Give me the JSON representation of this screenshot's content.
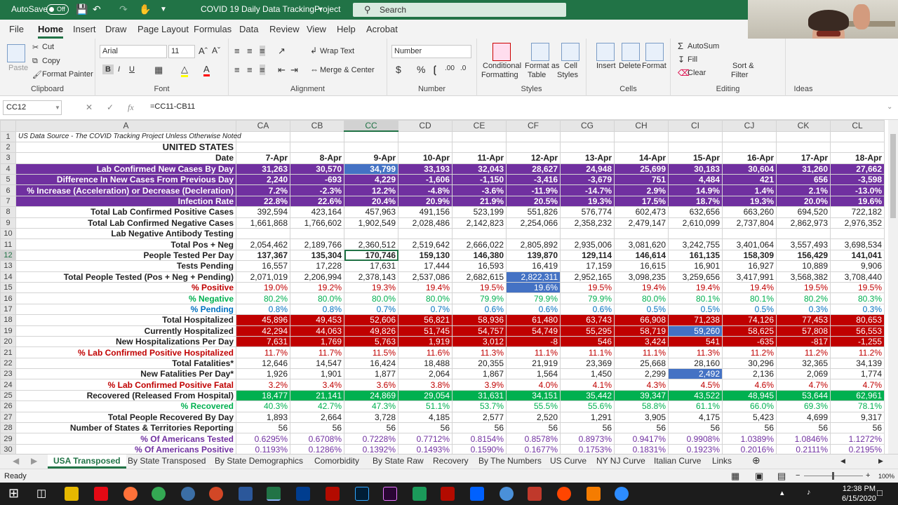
{
  "titlebar": {
    "autosave": "AutoSave",
    "autosave_state": "Off",
    "document": "COVID 19 Daily Data TrackingProject",
    "search_placeholder": "Search"
  },
  "menu": [
    "File",
    "Home",
    "Insert",
    "Draw",
    "Page Layout",
    "Formulas",
    "Data",
    "Review",
    "View",
    "Help",
    "Acrobat"
  ],
  "ribbon": {
    "clipboard": {
      "label": "Clipboard",
      "paste": "Paste",
      "cut": "Cut",
      "copy": "Copy",
      "format_painter": "Format Painter"
    },
    "font": {
      "label": "Font",
      "family": "Arial",
      "size": "11"
    },
    "alignment": {
      "label": "Alignment",
      "wrap": "Wrap Text",
      "merge": "Merge & Center"
    },
    "number": {
      "label": "Number",
      "format": "Number"
    },
    "styles": {
      "label": "Styles",
      "conditional": "Conditional",
      "formatting": "Formatting",
      "format_as": "Format as",
      "table": "Table",
      "cell": "Cell",
      "cell_styles": "Styles"
    },
    "cells": {
      "label": "Cells",
      "insert": "Insert",
      "delete": "Delete",
      "format": "Format"
    },
    "editing": {
      "label": "Editing",
      "autosum": "AutoSum",
      "fill": "Fill",
      "clear": "Clear",
      "sort": "Sort &",
      "filter": "Filter"
    },
    "ideas": {
      "label": "Ideas"
    }
  },
  "formula_bar": {
    "cell": "CC12",
    "formula": "=CC11-CB11"
  },
  "columns": [
    "",
    "A",
    "CA",
    "CB",
    "CC",
    "CD",
    "CE",
    "CF",
    "CG",
    "CH",
    "CI",
    "CJ",
    "CK",
    "CL"
  ],
  "rows": [
    {
      "n": "1",
      "label": "US Data Source - The COVID Tracking Project Unless Otherwise Noted",
      "v": [
        "",
        "",
        "",
        "",
        "",
        "",
        "",
        "",
        "",
        "",
        "",
        ""
      ]
    },
    {
      "n": "2",
      "label": "UNITED STATES",
      "v": [
        "",
        "",
        "",
        "",
        "",
        "",
        "",
        "",
        "",
        "",
        "",
        ""
      ]
    },
    {
      "n": "3",
      "label": "Date",
      "v": [
        "7-Apr",
        "8-Apr",
        "9-Apr",
        "10-Apr",
        "11-Apr",
        "12-Apr",
        "13-Apr",
        "14-Apr",
        "15-Apr",
        "16-Apr",
        "17-Apr",
        "18-Apr"
      ]
    },
    {
      "n": "4",
      "label": "Lab Confirmed New Cases By Day",
      "v": [
        "31,263",
        "30,570",
        "34,799",
        "33,193",
        "32,043",
        "28,627",
        "24,948",
        "25,699",
        "30,183",
        "30,604",
        "31,260",
        "27,662"
      ]
    },
    {
      "n": "5",
      "label": "Difference In New Cases From Previous Day",
      "v": [
        "2,240",
        "-693",
        "4,229",
        "-1,606",
        "-1,150",
        "-3,416",
        "-3,679",
        "751",
        "4,484",
        "421",
        "656",
        "-3,598"
      ]
    },
    {
      "n": "6",
      "label": "% Increase (Acceleration) or Decrease (Decleration)",
      "v": [
        "7.2%",
        "-2.3%",
        "12.2%",
        "-4.8%",
        "-3.6%",
        "-11.9%",
        "-14.7%",
        "2.9%",
        "14.9%",
        "1.4%",
        "2.1%",
        "-13.0%"
      ]
    },
    {
      "n": "7",
      "label": "Infection Rate",
      "v": [
        "22.8%",
        "22.6%",
        "20.4%",
        "20.9%",
        "21.9%",
        "20.5%",
        "19.3%",
        "17.5%",
        "18.7%",
        "19.3%",
        "20.0%",
        "19.6%"
      ]
    },
    {
      "n": "8",
      "label": "Total Lab Confirmed Positive Cases",
      "v": [
        "392,594",
        "423,164",
        "457,963",
        "491,156",
        "523,199",
        "551,826",
        "576,774",
        "602,473",
        "632,656",
        "663,260",
        "694,520",
        "722,182"
      ]
    },
    {
      "n": "9",
      "label": "Total Lab Confirmed Negative Cases",
      "v": [
        "1,661,868",
        "1,766,602",
        "1,902,549",
        "2,028,486",
        "2,142,823",
        "2,254,066",
        "2,358,232",
        "2,479,147",
        "2,610,099",
        "2,737,804",
        "2,862,973",
        "2,976,352"
      ]
    },
    {
      "n": "10",
      "label": "Lab Negative Antibody Testing",
      "v": [
        "",
        "",
        "",
        "",
        "",
        "",
        "",
        "",
        "",
        "",
        "",
        ""
      ]
    },
    {
      "n": "11",
      "label": "Total Pos + Neg",
      "v": [
        "2,054,462",
        "2,189,766",
        "2,360,512",
        "2,519,642",
        "2,666,022",
        "2,805,892",
        "2,935,006",
        "3,081,620",
        "3,242,755",
        "3,401,064",
        "3,557,493",
        "3,698,534"
      ]
    },
    {
      "n": "12",
      "label": "People Tested Per Day",
      "v": [
        "137,367",
        "135,304",
        "170,746",
        "159,130",
        "146,380",
        "139,870",
        "129,114",
        "146,614",
        "161,135",
        "158,309",
        "156,429",
        "141,041"
      ]
    },
    {
      "n": "13",
      "label": "Tests Pending",
      "v": [
        "16,557",
        "17,228",
        "17,631",
        "17,444",
        "16,593",
        "16,419",
        "17,159",
        "16,615",
        "16,901",
        "16,927",
        "10,889",
        "9,906"
      ]
    },
    {
      "n": "14",
      "label": "Total People Tested (Pos + Neg + Pending)",
      "v": [
        "2,071,019",
        "2,206,994",
        "2,378,143",
        "2,537,086",
        "2,682,615",
        "2,822,311",
        "2,952,165",
        "3,098,235",
        "3,259,656",
        "3,417,991",
        "3,568,382",
        "3,708,440"
      ]
    },
    {
      "n": "15",
      "label": "% Positive",
      "v": [
        "19.0%",
        "19.2%",
        "19.3%",
        "19.4%",
        "19.5%",
        "19.6%",
        "19.5%",
        "19.4%",
        "19.4%",
        "19.4%",
        "19.5%",
        "19.5%"
      ]
    },
    {
      "n": "16",
      "label": "% Negative",
      "v": [
        "80.2%",
        "80.0%",
        "80.0%",
        "80.0%",
        "79.9%",
        "79.9%",
        "79.9%",
        "80.0%",
        "80.1%",
        "80.1%",
        "80.2%",
        "80.3%"
      ]
    },
    {
      "n": "17",
      "label": "% Pending",
      "v": [
        "0.8%",
        "0.8%",
        "0.7%",
        "0.7%",
        "0.6%",
        "0.6%",
        "0.6%",
        "0.5%",
        "0.5%",
        "0.5%",
        "0.3%",
        "0.3%"
      ]
    },
    {
      "n": "18",
      "label": "Total Hospitalized",
      "v": [
        "45,896",
        "49,453",
        "52,606",
        "56,821",
        "58,936",
        "61,480",
        "63,743",
        "66,908",
        "71,238",
        "74,126",
        "77,453",
        "80,653"
      ]
    },
    {
      "n": "19",
      "label": "Currently Hospitalized",
      "v": [
        "42,294",
        "44,063",
        "49,826",
        "51,745",
        "54,757",
        "54,749",
        "55,295",
        "58,719",
        "59,260",
        "58,625",
        "57,808",
        "56,553"
      ]
    },
    {
      "n": "20",
      "label": "New Hospitalizations Per Day",
      "v": [
        "7,631",
        "1,769",
        "5,763",
        "1,919",
        "3,012",
        "-8",
        "546",
        "3,424",
        "541",
        "-635",
        "-817",
        "-1,255"
      ]
    },
    {
      "n": "21",
      "label": "% Lab Confirmed Positive Hospitalized",
      "v": [
        "11.7%",
        "11.7%",
        "11.5%",
        "11.6%",
        "11.3%",
        "11.1%",
        "11.1%",
        "11.1%",
        "11.3%",
        "11.2%",
        "11.2%",
        "11.2%"
      ]
    },
    {
      "n": "22",
      "label": "Total Fatalities*",
      "v": [
        "12,646",
        "14,547",
        "16,424",
        "18,488",
        "20,355",
        "21,919",
        "23,369",
        "25,668",
        "28,160",
        "30,296",
        "32,365",
        "34,139"
      ]
    },
    {
      "n": "23",
      "label": "New Fatalities Per Day*",
      "v": [
        "1,926",
        "1,901",
        "1,877",
        "2,064",
        "1,867",
        "1,564",
        "1,450",
        "2,299",
        "2,492",
        "2,136",
        "2,069",
        "1,774"
      ]
    },
    {
      "n": "24",
      "label": "% Lab Confirmed Positive Fatal",
      "v": [
        "3.2%",
        "3.4%",
        "3.6%",
        "3.8%",
        "3.9%",
        "4.0%",
        "4.1%",
        "4.3%",
        "4.5%",
        "4.6%",
        "4.7%",
        "4.7%"
      ]
    },
    {
      "n": "25",
      "label": "Recovered (Released From Hospital)",
      "v": [
        "18,477",
        "21,141",
        "24,869",
        "29,054",
        "31,631",
        "34,151",
        "35,442",
        "39,347",
        "43,522",
        "48,945",
        "53,644",
        "62,961"
      ]
    },
    {
      "n": "26",
      "label": "% Recovered",
      "v": [
        "40.3%",
        "42.7%",
        "47.3%",
        "51.1%",
        "53.7%",
        "55.5%",
        "55.6%",
        "58.8%",
        "61.1%",
        "66.0%",
        "69.3%",
        "78.1%"
      ]
    },
    {
      "n": "27",
      "label": "Total People Recovered By Day",
      "v": [
        "1,893",
        "2,664",
        "3,728",
        "4,185",
        "2,577",
        "2,520",
        "1,291",
        "3,905",
        "4,175",
        "5,423",
        "4,699",
        "9,317"
      ]
    },
    {
      "n": "28",
      "label": "Number of States & Territories Reporting",
      "v": [
        "56",
        "56",
        "56",
        "56",
        "56",
        "56",
        "56",
        "56",
        "56",
        "56",
        "56",
        "56"
      ]
    },
    {
      "n": "29",
      "label": "% Of Americans Tested",
      "v": [
        "0.6295%",
        "0.6708%",
        "0.7228%",
        "0.7712%",
        "0.8154%",
        "0.8578%",
        "0.8973%",
        "0.9417%",
        "0.9908%",
        "1.0389%",
        "1.0846%",
        "1.1272%"
      ]
    },
    {
      "n": "30",
      "label": "% Of Americans Positive",
      "v": [
        "0.1193%",
        "0.1286%",
        "0.1392%",
        "0.1493%",
        "0.1590%",
        "0.1677%",
        "0.1753%",
        "0.1831%",
        "0.1923%",
        "0.2016%",
        "0.2111%",
        "0.2195%"
      ]
    }
  ],
  "sheets": [
    "USA Transposed",
    "By State Transposed",
    "By State Demographics",
    "Comorbidity",
    "By State Raw",
    "Recovery",
    "By The Numbers",
    "US Curve",
    "NY NJ Curve",
    "Italian Curve",
    "Links"
  ],
  "status": {
    "ready": "Ready",
    "zoom": "100%"
  },
  "clock": {
    "time": "12:38 PM",
    "date": "6/15/2020"
  }
}
